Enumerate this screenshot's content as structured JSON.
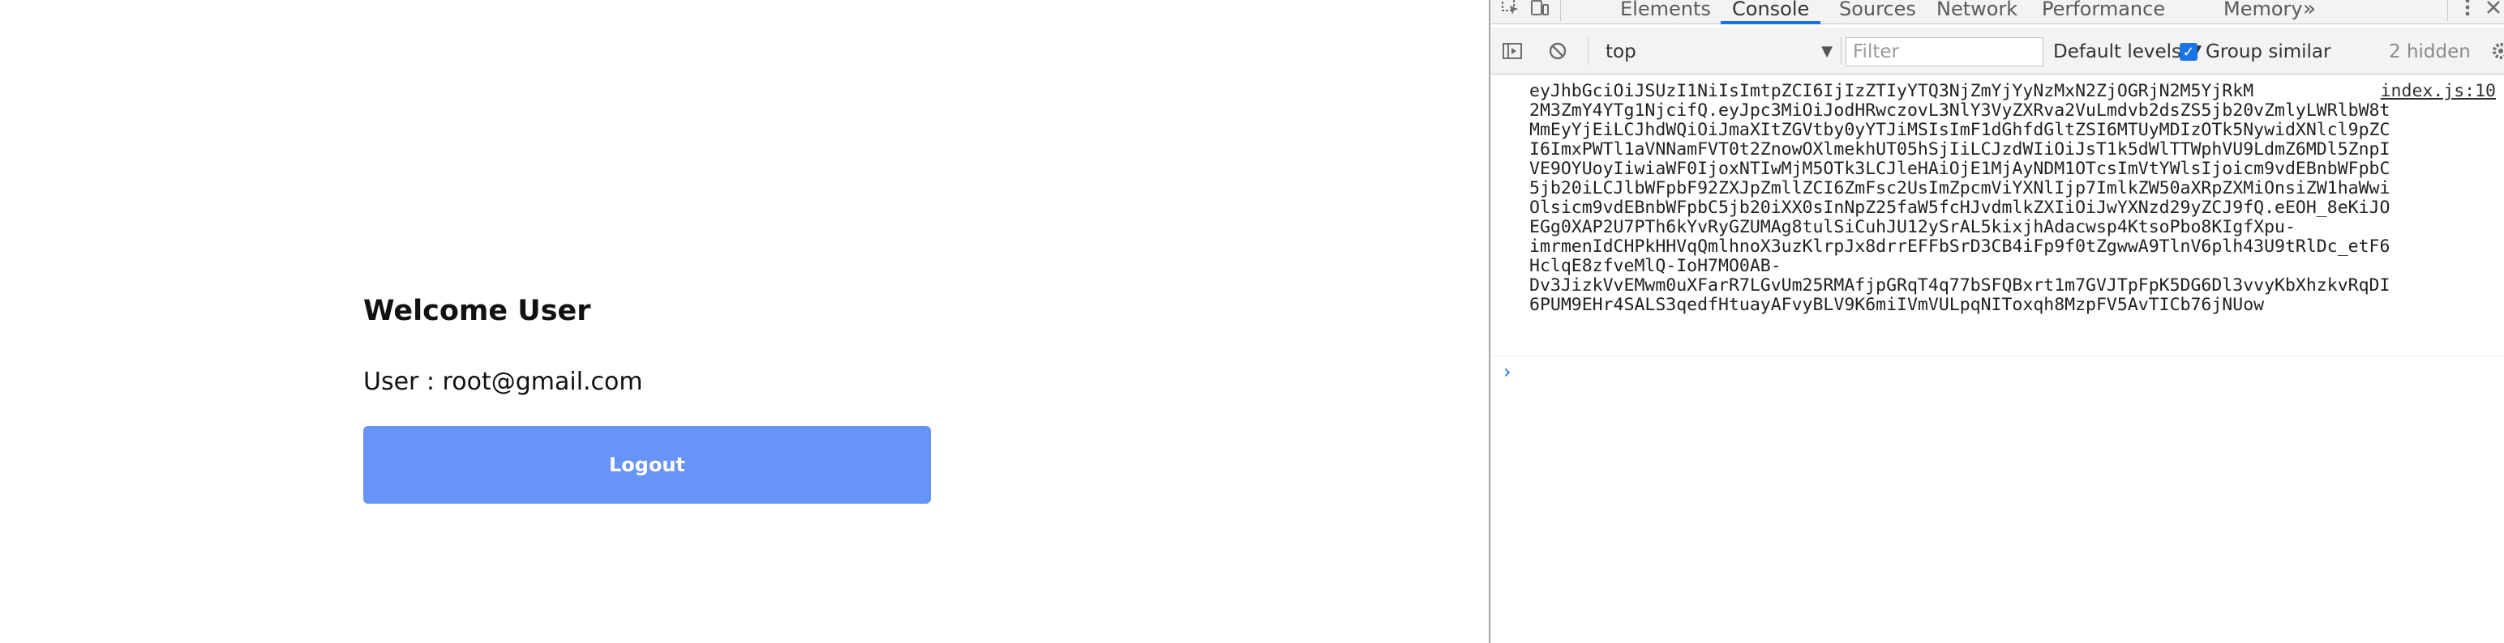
{
  "page": {
    "heading": "Welcome User",
    "user_line": "User : root@gmail.com",
    "logout_label": "Logout",
    "button_color": "#6893f7"
  },
  "devtools": {
    "tabs": [
      "Elements",
      "Console",
      "Sources",
      "Network",
      "Performance",
      "Memory"
    ],
    "active_tab": "Console",
    "overflow_glyph": "»",
    "toolbar": {
      "context": "top",
      "filter_placeholder": "Filter",
      "levels": "Default levels ▼",
      "group_similar": "Group similar",
      "hidden_count": "2 hidden"
    },
    "console": {
      "source_link": "index.js:10",
      "message_lines": [
        "eyJhbGciOiJSUzI1NiIsImtpZCI6IjIzZTIyYTQ3NjZmYjYyNzMxN2ZjOGRjN2M5YjRkM",
        "2M3ZmY4YTg1NjcifQ.eyJpc3MiOiJodHRwczovL3NlY3VyZXRva2VuLmdvb2dsZS5jb20vZmlyLWRlbW8t",
        "MmEyYjEiLCJhdWQiOiJmaXItZGVtby0yYTJiMSIsImF1dGhfdGltZSI6MTUyMDIzOTk5NywidXNlcl9pZC",
        "I6ImxPWTl1aVNNamFVT0t2ZnowOXlmekhUT05hSjIiLCJzdWIiOiJsT1k5dWlTTWphVU9LdmZ6MDl5ZnpI",
        "VE9OYUoyIiwiaWF0IjoxNTIwMjM5OTk3LCJleHAiOjE1MjAyNDM1OTcsImVtYWlsIjoicm9vdEBnbWFpbC",
        "5jb20iLCJlbWFpbF92ZXJpZmllZCI6ZmFsc2UsImZpcmViYXNlIjp7ImlkZW50aXRpZXMiOnsiZW1haWwi",
        "Olsicm9vdEBnbWFpbC5jb20iXX0sInNpZ25faW5fcHJvdmlkZXIiOiJwYXNzd29yZCJ9fQ.eEOH_8eKiJO",
        "EGg0XAP2U7PTh6kYvRyGZUMAg8tulSiCuhJU12ySrAL5kixjhAdacwsp4KtsoPbo8KIgfXpu-",
        "imrmenIdCHPkHHVqQmlhnoX3uzKlrpJx8drrEFFbSrD3CB4iFp9f0tZgwwA9TlnV6plh43U9tRlDc_etF6",
        "HclqE8zfveMlQ-IoH7MO0AB-",
        "Dv3JizkVvEMwm0uXFarR7LGvUm25RMAfjpGRqT4q77bSFQBxrt1m7GVJTpFpK5DG6Dl3vvyKbXhzkvRqDI",
        "6PUM9EHr4SALS3qedfHtuayAFvyBLV9K6miIVmVULpqNIToxqh8MzpFV5AvTICb76jNUow"
      ],
      "prompt_glyph": "›"
    },
    "accent_color": "#1a73e8"
  }
}
